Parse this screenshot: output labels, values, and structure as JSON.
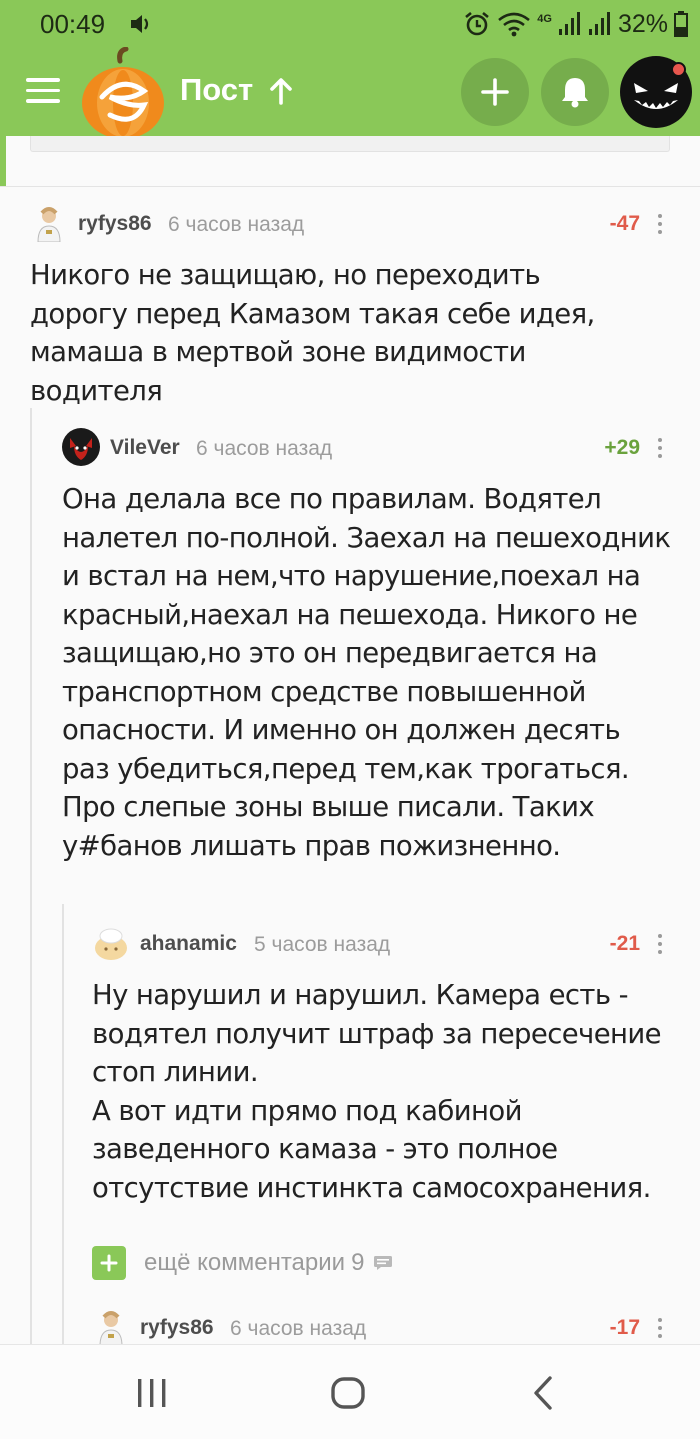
{
  "status_bar": {
    "time": "00:49",
    "battery": "32%",
    "network": "4G",
    "icons": [
      "volume-icon",
      "alarm-icon",
      "wifi-icon",
      "signal-icon",
      "battery-icon"
    ]
  },
  "app_bar": {
    "title": "Пост",
    "icons": [
      "menu-icon",
      "pumpkin-logo",
      "arrow-up-icon",
      "plus-icon",
      "bell-icon",
      "avatar"
    ]
  },
  "comments": [
    {
      "user": "ryfys86",
      "time": "6 часов назад",
      "rating": "-47",
      "text": "Никого не защищаю, но переходить дорогу перед Камазом такая себе идея, мамаша в мертвой зоне видимости водителя"
    },
    {
      "user": "VileVer",
      "time": "6 часов назад",
      "rating": "+29",
      "text": "Она делала все по правилам. Водятел налетел по-полной. Заехал на пешеходник и встал на нем,что нарушение,поехал на красный,наехал на пешехода. Никого не защищаю,но это он передвигается на транспортном средстве повышенной опасности. И именно он должен десять раз убедиться,перед тем,как трогаться. Про слепые зоны выше писали. Таких у#банов лишать прав пожизненно."
    },
    {
      "user": "ahanamic",
      "time": "5 часов назад",
      "rating": "-21",
      "text": "Ну нарушил и нарушил. Камера есть - водятел получит штраф за пересечение стоп линии.\nА вот идти прямо под кабиной заведенного камаза - это полное отсутствие инстинкта самосохранения."
    },
    {
      "user": "ryfys86",
      "time": "6 часов назад",
      "rating": "-17"
    }
  ],
  "more_comments": {
    "label": "ещё комментарии",
    "count": "9"
  },
  "colors": {
    "brand_green": "#8ac858",
    "negative": "#e05b4a",
    "positive": "#6aa23d"
  }
}
